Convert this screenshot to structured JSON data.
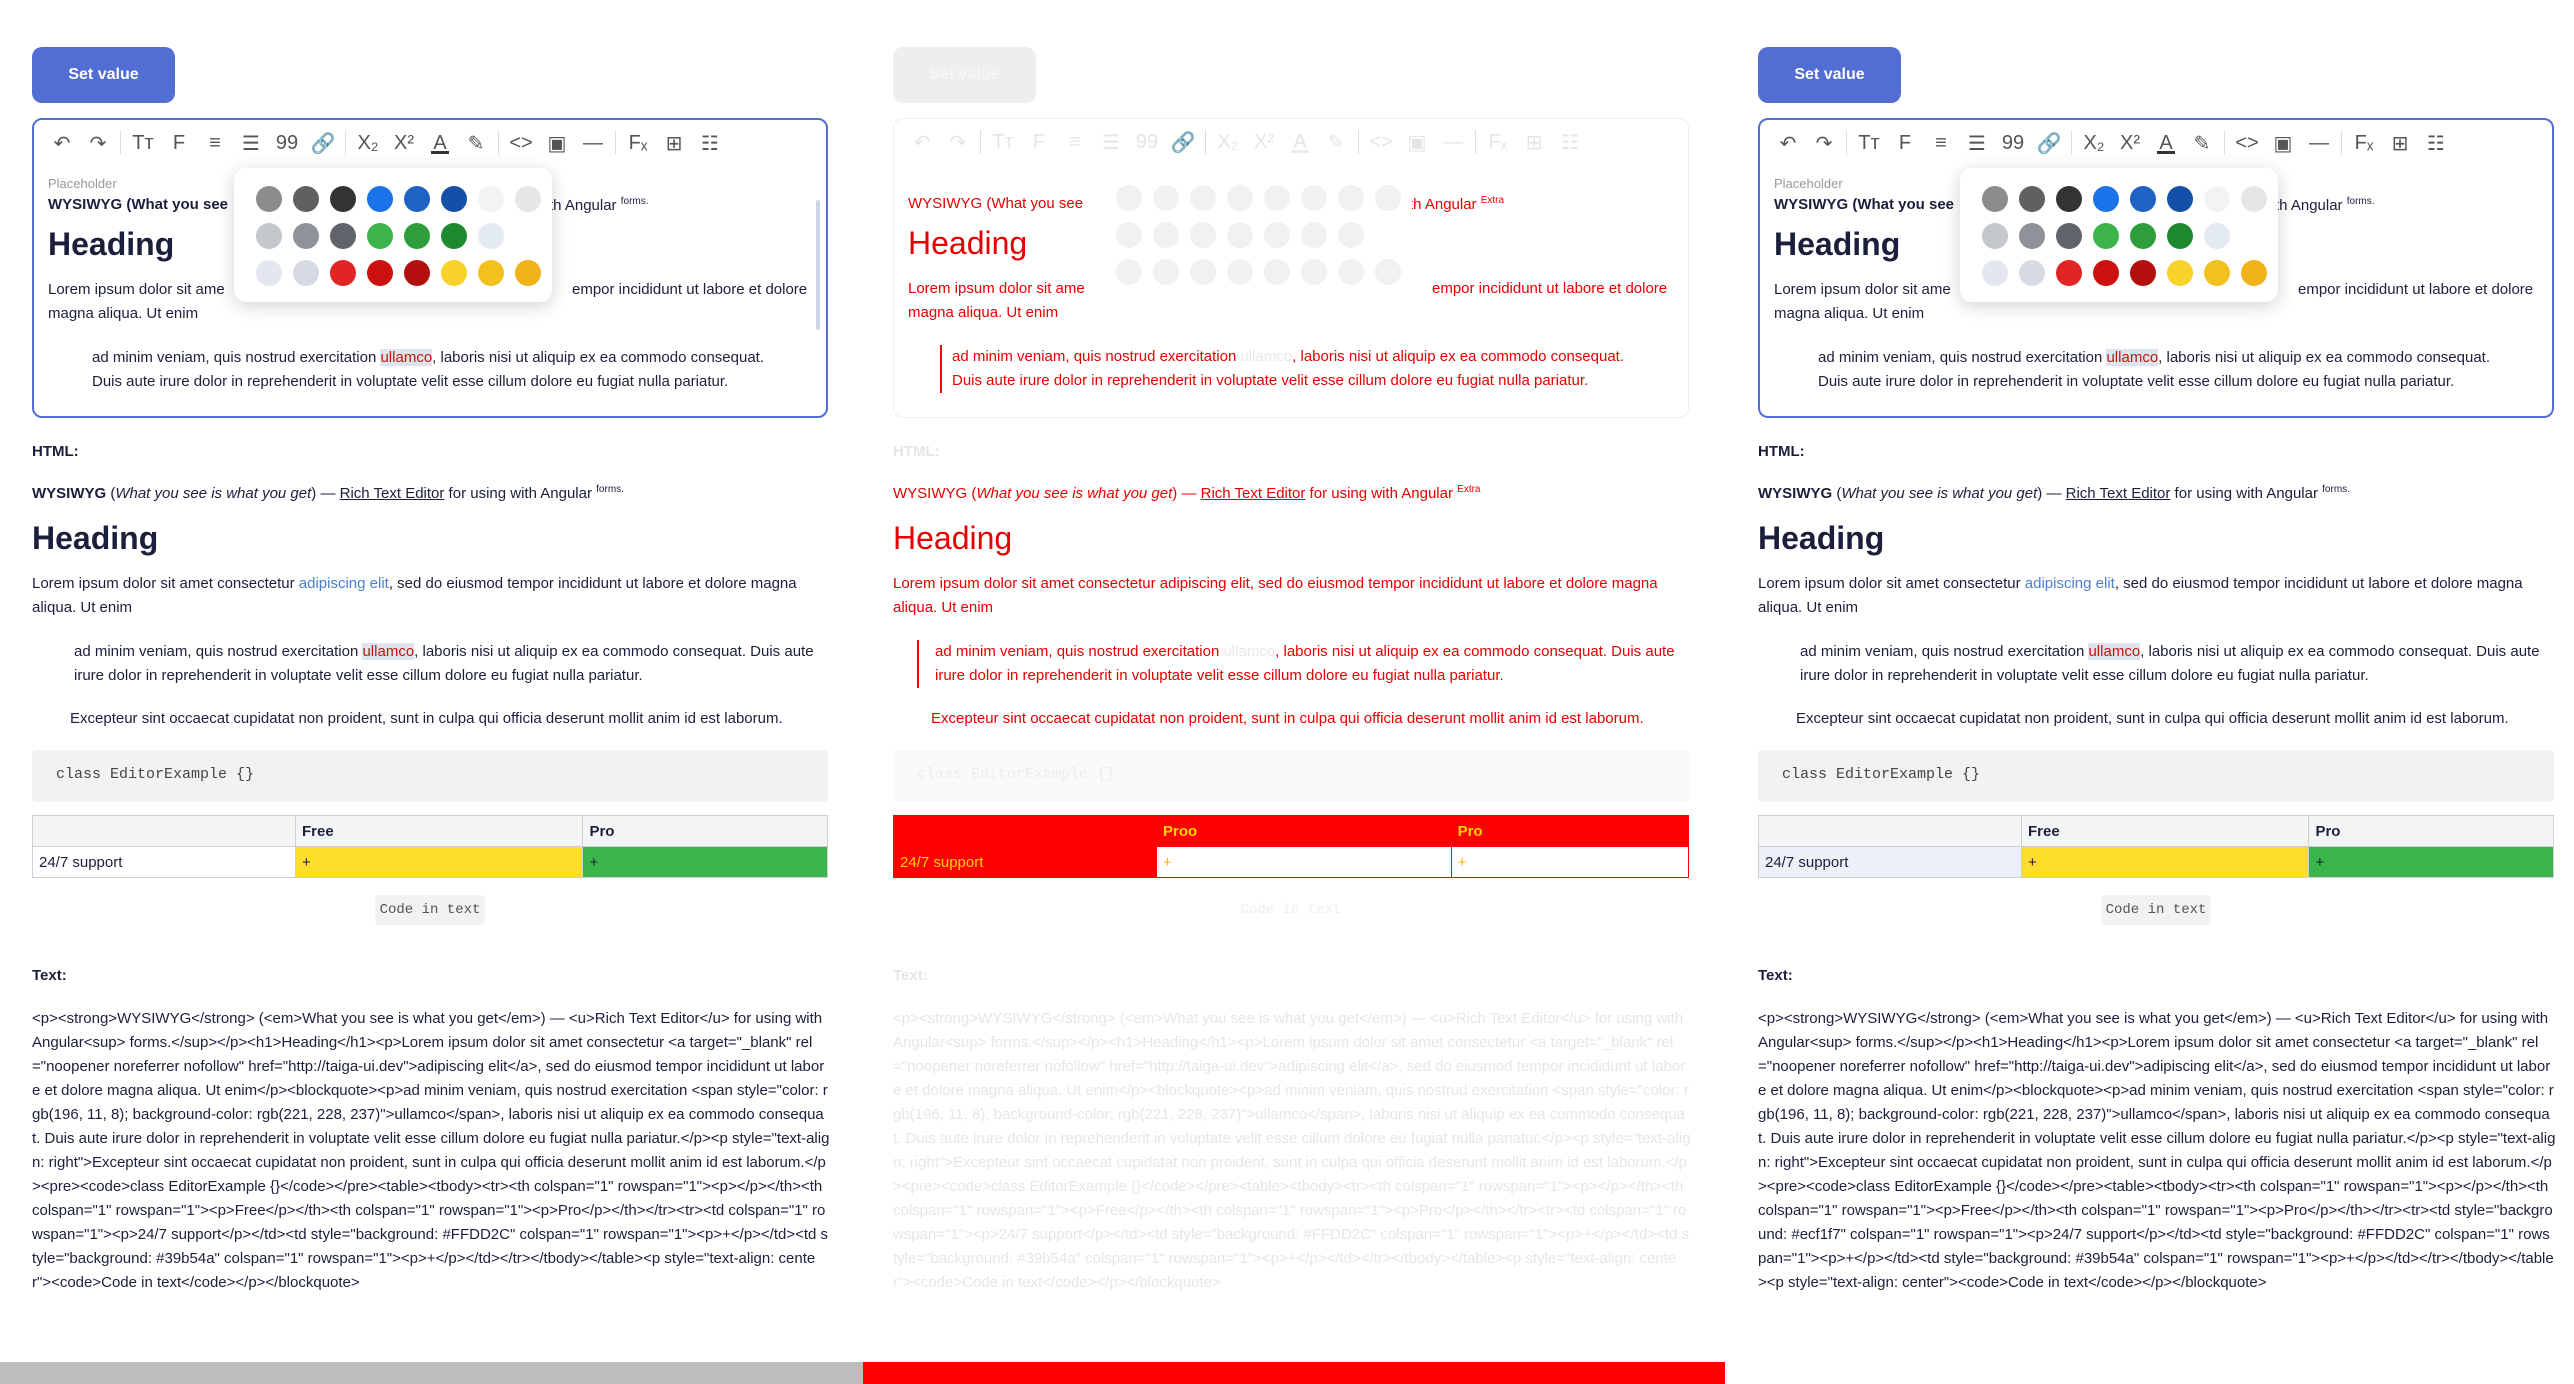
{
  "set_value_label": "Set value",
  "toolbar_icons": [
    "undo-icon",
    "redo-icon",
    "font-size-icon",
    "font-style-icon",
    "align-icon",
    "list-icon",
    "quote-icon",
    "link-icon",
    "subscript-icon",
    "superscript-icon",
    "text-color-icon",
    "highlight-icon",
    "code-icon",
    "image-icon",
    "horizontal-rule-icon",
    "clear-format-icon",
    "table-icon",
    "row-icon"
  ],
  "toolbar_glyphs": [
    "↶",
    "↷",
    "Tт",
    "F",
    "≡",
    "☰",
    "99",
    "🔗",
    "X₂",
    "X²",
    "A",
    "✎",
    "<>",
    "▣",
    "—",
    "Fₓ",
    "⊞",
    "☷"
  ],
  "editor": {
    "placeholder": "Placeholder",
    "first_line": "WYSIWYG (What you see",
    "first_line_tail": "th Angular",
    "first_sup": "forms.",
    "heading": "Heading",
    "para": "Lorem ipsum dolor sit ame",
    "para_tail": "empor incididunt ut labore et dolore",
    "para_line2": "magna aliqua. Ut enim",
    "quote_pre": "ad minim veniam, quis nostrud exercitation ",
    "quote_hl": "ullamco",
    "quote_post": ", laboris nisi ut aliquip ex ea commodo consequat.",
    "quote_line2": "Duis aute irure dolor in reprehenderit in voluptate velit esse cillum dolore eu fugiat nulla pariatur."
  },
  "palette_colors": [
    [
      "#8c8c8c",
      "#606060",
      "#333333",
      "#1a73e8",
      "#1e62c4",
      "#1450a8",
      "#f3f3f3",
      "#e6e6e6"
    ],
    [
      "#c4c7cc",
      "#8e9299",
      "#5f636a",
      "#3cb44a",
      "#2e9e3c",
      "#1e8a2e",
      "#e4eaf2"
    ],
    [
      "#e3e7ef",
      "#d5dae4",
      "#e32424",
      "#cc1111",
      "#b30f0f",
      "#f8d12b",
      "#f2c11f",
      "#f0b31a"
    ]
  ],
  "html_label": "HTML:",
  "html": {
    "title_strong": "WYSIWYG",
    "title_em": "What you see is what you get",
    "dash": " — ",
    "rte": "Rich Text Editor",
    "tail": " for using with Angular ",
    "sup": "forms.",
    "sup_broken": "Extra",
    "heading": "Heading",
    "para_pre": "Lorem ipsum dolor sit amet consectetur ",
    "para_link": "adipiscing elit",
    "para_post": ", sed do eiusmod tempor incididunt ut labore et dolore magna aliqua. Ut enim",
    "quote_pre": "ad minim veniam, quis nostrud exercitation ",
    "quote_hl": "ullamco",
    "quote_post": ", laboris nisi ut aliquip ex ea commodo consequat. Duis aute irure dolor in reprehenderit in voluptate velit esse cillum dolore eu fugiat nulla pariatur.",
    "right_para": "Excepteur sint occaecat cupidatat non proident, sunt in culpa qui officia deserunt mollit anim id est laborum.",
    "code": "class EditorExample {}",
    "table_headers": [
      "",
      "Free",
      "Pro"
    ],
    "table_headers_broken": [
      "",
      "Proo",
      "Pro"
    ],
    "table_row_label": "24/7 support",
    "table_plus": "+",
    "code_inline": "Code in text"
  },
  "text_label": "Text:",
  "text_raw_0": "<p><strong>WYSIWYG</strong> (<em>What you see is what you get</em>) — <u>Rich Text Editor</u> for using with Angular<sup> forms.</sup></p><h1>Heading</h1><p>Lorem ipsum dolor sit amet consectetur <a target=\"_blank\" rel=\"noopener noreferrer nofollow\" href=\"http://taiga-ui.dev\">adipiscing elit</a>, sed do eiusmod tempor incididunt ut labore et dolore magna aliqua. Ut enim</p><blockquote><p>ad minim veniam, quis nostrud exercitation <span style=\"color: rgb(196, 11, 8); background-color: rgb(221, 228, 237)\">ullamco</span>, laboris nisi ut aliquip ex ea commodo consequat. Duis aute irure dolor in reprehenderit in voluptate velit esse cillum dolore eu fugiat nulla pariatur.</p><p style=\"text-align: right\">Excepteur sint occaecat cupidatat non proident, sunt in culpa qui officia deserunt mollit anim id est laborum.</p><pre><code>class EditorExample {}</code></pre><table><tbody><tr><th colspan=\"1\" rowspan=\"1\"><p></p></th><th colspan=\"1\" rowspan=\"1\"><p>Free</p></th><th colspan=\"1\" rowspan=\"1\"><p>Pro</p></th></tr><tr><td colspan=\"1\" rowspan=\"1\"><p>24/7 support</p></td><td style=\"background: #FFDD2C\" colspan=\"1\" rowspan=\"1\"><p>+</p></td><td style=\"background: #39b54a\" colspan=\"1\" rowspan=\"1\"><p>+</p></td></tr></tbody></table><p style=\"text-align: center\"><code>Code in text</code></p></blockquote>",
  "text_raw_2": "<p><strong>WYSIWYG</strong> (<em>What you see is what you get</em>) — <u>Rich Text Editor</u> for using with Angular<sup> forms.</sup></p><h1>Heading</h1><p>Lorem ipsum dolor sit amet consectetur <a target=\"_blank\" rel=\"noopener noreferrer nofollow\" href=\"http://taiga-ui.dev\">adipiscing elit</a>, sed do eiusmod tempor incididunt ut labore et dolore magna aliqua. Ut enim</p><blockquote><p>ad minim veniam, quis nostrud exercitation <span style=\"color: rgb(196, 11, 8); background-color: rgb(221, 228, 237)\">ullamco</span>, laboris nisi ut aliquip ex ea commodo consequat. Duis aute irure dolor in reprehenderit in voluptate velit esse cillum dolore eu fugiat nulla pariatur.</p><p style=\"text-align: right\">Excepteur sint occaecat cupidatat non proident, sunt in culpa qui officia deserunt mollit anim id est laborum.</p><pre><code>class EditorExample {}</code></pre><table><tbody><tr><th colspan=\"1\" rowspan=\"1\"><p></p></th><th colspan=\"1\" rowspan=\"1\"><p>Free</p></th><th colspan=\"1\" rowspan=\"1\"><p>Pro</p></th></tr><tr><td style=\"background: #ecf1f7\" colspan=\"1\" rowspan=\"1\"><p>24/7 support</p></td><td style=\"background: #FFDD2C\" colspan=\"1\" rowspan=\"1\"><p>+</p></td><td style=\"background: #39b54a\" colspan=\"1\" rowspan=\"1\"><p>+</p></td></tr></tbody></table><p style=\"text-align: center\"><code>Code in text</code></p></blockquote>",
  "colors": {
    "accent": "#526ed3",
    "yellow": "#FFDD2C",
    "green": "#39b54a",
    "broken_red": "#ff0000",
    "row_label_bg": "#ecf1f7",
    "scrollbar_gray": "#bdbdbd"
  }
}
